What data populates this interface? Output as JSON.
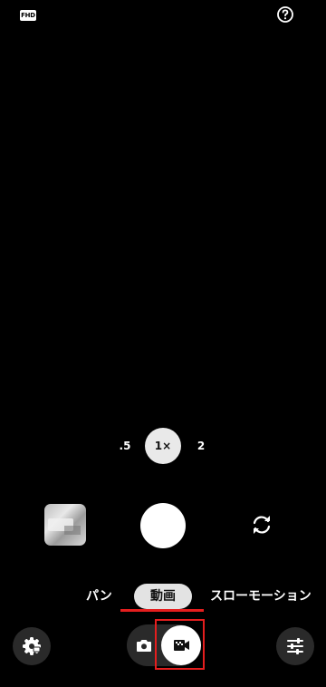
{
  "top_bar": {
    "resolution_badge": "FHD",
    "help_icon": "help-circle-icon"
  },
  "zoom": {
    "options": [
      ".5",
      "1×",
      "2"
    ],
    "selected": "1×"
  },
  "controls": {
    "gallery_icon": "gallery-thumbnail",
    "shutter_icon": "shutter-button",
    "switch_camera_icon": "switch-camera-icon"
  },
  "modes": {
    "items": [
      "パン",
      "動画",
      "スローモーション"
    ],
    "selected": "動画"
  },
  "bottom_bar": {
    "settings_icon": "camera-settings-icon",
    "photo_icon": "camera-icon",
    "video_icon": "video-camera-icon",
    "adjust_icon": "sliders-icon"
  },
  "colors": {
    "background": "#000000",
    "highlight": "#e41e1e"
  }
}
